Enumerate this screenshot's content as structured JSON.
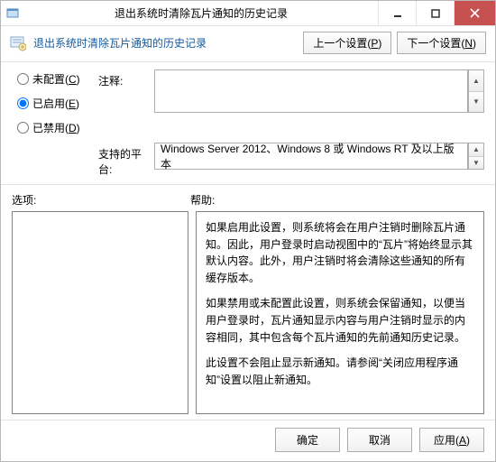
{
  "title": "退出系统时清除瓦片通知的历史记录",
  "header_title": "退出系统时清除瓦片通知的历史记录",
  "nav": {
    "prev": "上一个设置(P)",
    "next": "下一个设置(N)"
  },
  "radios": {
    "not_configured": "未配置(C)",
    "enabled": "已启用(E)",
    "disabled": "已禁用(D)",
    "selected": "enabled"
  },
  "labels": {
    "comment": "注释:",
    "platform": "支持的平台:",
    "options": "选项:",
    "help": "帮助:"
  },
  "comment_value": "",
  "platform_value": "Windows Server 2012、Windows 8 或 Windows RT 及以上版本",
  "help_paragraphs": [
    "如果启用此设置，则系统将会在用户注销时删除瓦片通知。因此，用户登录时启动视图中的“瓦片”将始终显示其默认内容。此外，用户注销时将会清除这些通知的所有缓存版本。",
    "如果禁用或未配置此设置，则系统会保留通知，以便当用户登录时，瓦片通知显示内容与用户注销时显示的内容相同，其中包含每个瓦片通知的先前通知历史记录。",
    "此设置不会阻止显示新通知。请参阅“关闭应用程序通知”设置以阻止新通知。"
  ],
  "buttons": {
    "ok": "确定",
    "cancel": "取消",
    "apply": "应用(A)"
  }
}
